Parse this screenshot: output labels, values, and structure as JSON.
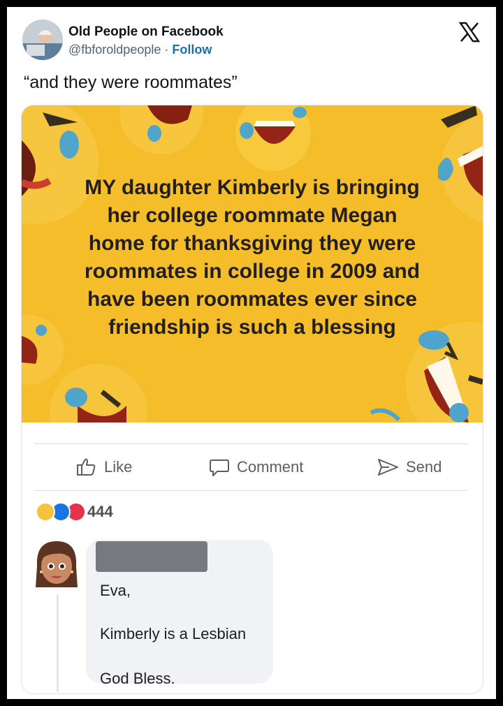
{
  "tweet": {
    "account_name": "Old People on Facebook",
    "handle": "@fbforoldpeople",
    "separator": "·",
    "follow_label": "Follow",
    "text": "“and they were roommates”"
  },
  "meme": {
    "lines": [
      "MY daughter Kimberly is bringing",
      "her college roommate Megan",
      "home for thanksgiving they were",
      "roommates in college in 2009 and",
      "have been roommates ever since",
      "friendship is such a blessing"
    ]
  },
  "post_actions": {
    "like_label": "Like",
    "comment_label": "Comment",
    "send_label": "Send"
  },
  "reactions": {
    "count": "444"
  },
  "comment": {
    "line1": "Eva,",
    "line2": "Kimberly is a Lesbian",
    "line3": "God Bless."
  },
  "colors": {
    "meme_background": "#f5bd2a",
    "follow_link": "#1d6fa8",
    "outer_border": "#000000"
  }
}
